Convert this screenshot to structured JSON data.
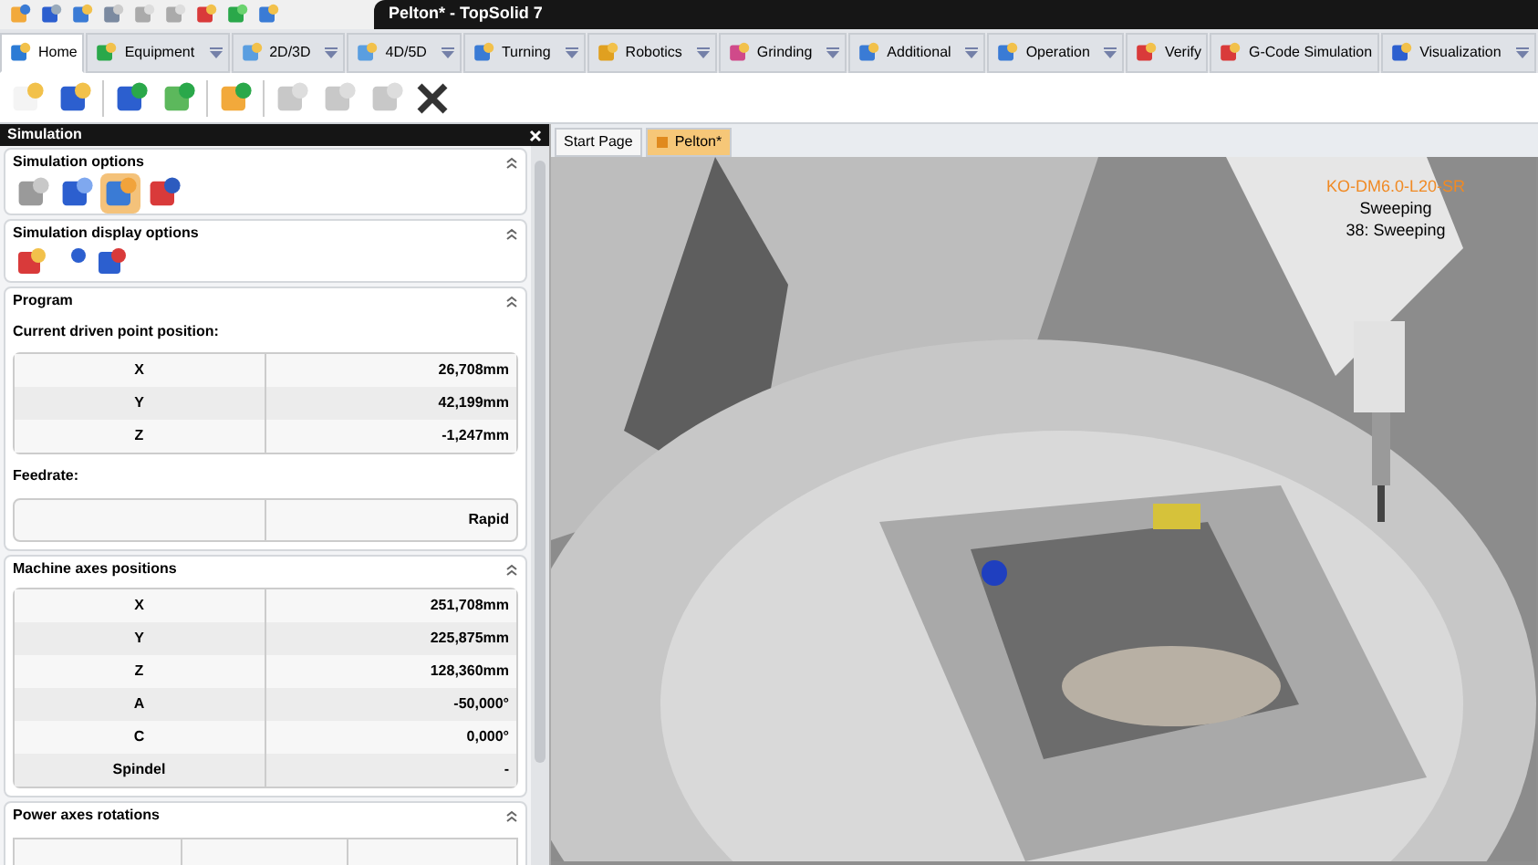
{
  "window": {
    "title": "Pelton* - TopSolid 7"
  },
  "ribbon_tabs": [
    {
      "label": "Home",
      "selected": true,
      "has_menu": false
    },
    {
      "label": "Equipment",
      "selected": false,
      "has_menu": true
    },
    {
      "label": "2D/3D",
      "selected": false,
      "has_menu": true
    },
    {
      "label": "4D/5D",
      "selected": false,
      "has_menu": true
    },
    {
      "label": "Turning",
      "selected": false,
      "has_menu": true
    },
    {
      "label": "Robotics",
      "selected": false,
      "has_menu": true
    },
    {
      "label": "Grinding",
      "selected": false,
      "has_menu": true
    },
    {
      "label": "Additional",
      "selected": false,
      "has_menu": true
    },
    {
      "label": "Operation",
      "selected": false,
      "has_menu": true
    },
    {
      "label": "Verify",
      "selected": false,
      "has_menu": false
    },
    {
      "label": "G-Code Simulation",
      "selected": false,
      "has_menu": false
    },
    {
      "label": "Visualization",
      "selected": false,
      "has_menu": true
    }
  ],
  "panel": {
    "title": "Simulation",
    "simulation_options": {
      "title": "Simulation options",
      "buttons": [
        {
          "selected": false
        },
        {
          "selected": false
        },
        {
          "selected": true
        },
        {
          "selected": false
        }
      ]
    },
    "display_options": {
      "title": "Simulation display options"
    },
    "program": {
      "title": "Program",
      "driven_point": {
        "label": "Current driven point position:",
        "rows": [
          {
            "axis": "X",
            "value": "26,708mm"
          },
          {
            "axis": "Y",
            "value": "42,199mm"
          },
          {
            "axis": "Z",
            "value": "-1,247mm"
          }
        ]
      },
      "feedrate": {
        "label": "Feedrate:",
        "value": "Rapid"
      }
    },
    "machine_axes": {
      "title": "Machine axes positions",
      "rows": [
        {
          "axis": "X",
          "value": "251,708mm"
        },
        {
          "axis": "Y",
          "value": "225,875mm"
        },
        {
          "axis": "Z",
          "value": "128,360mm"
        },
        {
          "axis": "A",
          "value": "-50,000°"
        },
        {
          "axis": "C",
          "value": "0,000°"
        },
        {
          "axis": "Spindel",
          "value": "-"
        }
      ]
    },
    "power_axes": {
      "title": "Power axes rotations"
    }
  },
  "document_tabs": [
    {
      "label": "Start Page",
      "selected": false
    },
    {
      "label": "Pelton*",
      "selected": true
    }
  ],
  "viewport": {
    "tool_label": "KO-DM6.0-L20-SR",
    "operation": "Sweeping",
    "step": "38: Sweeping"
  }
}
